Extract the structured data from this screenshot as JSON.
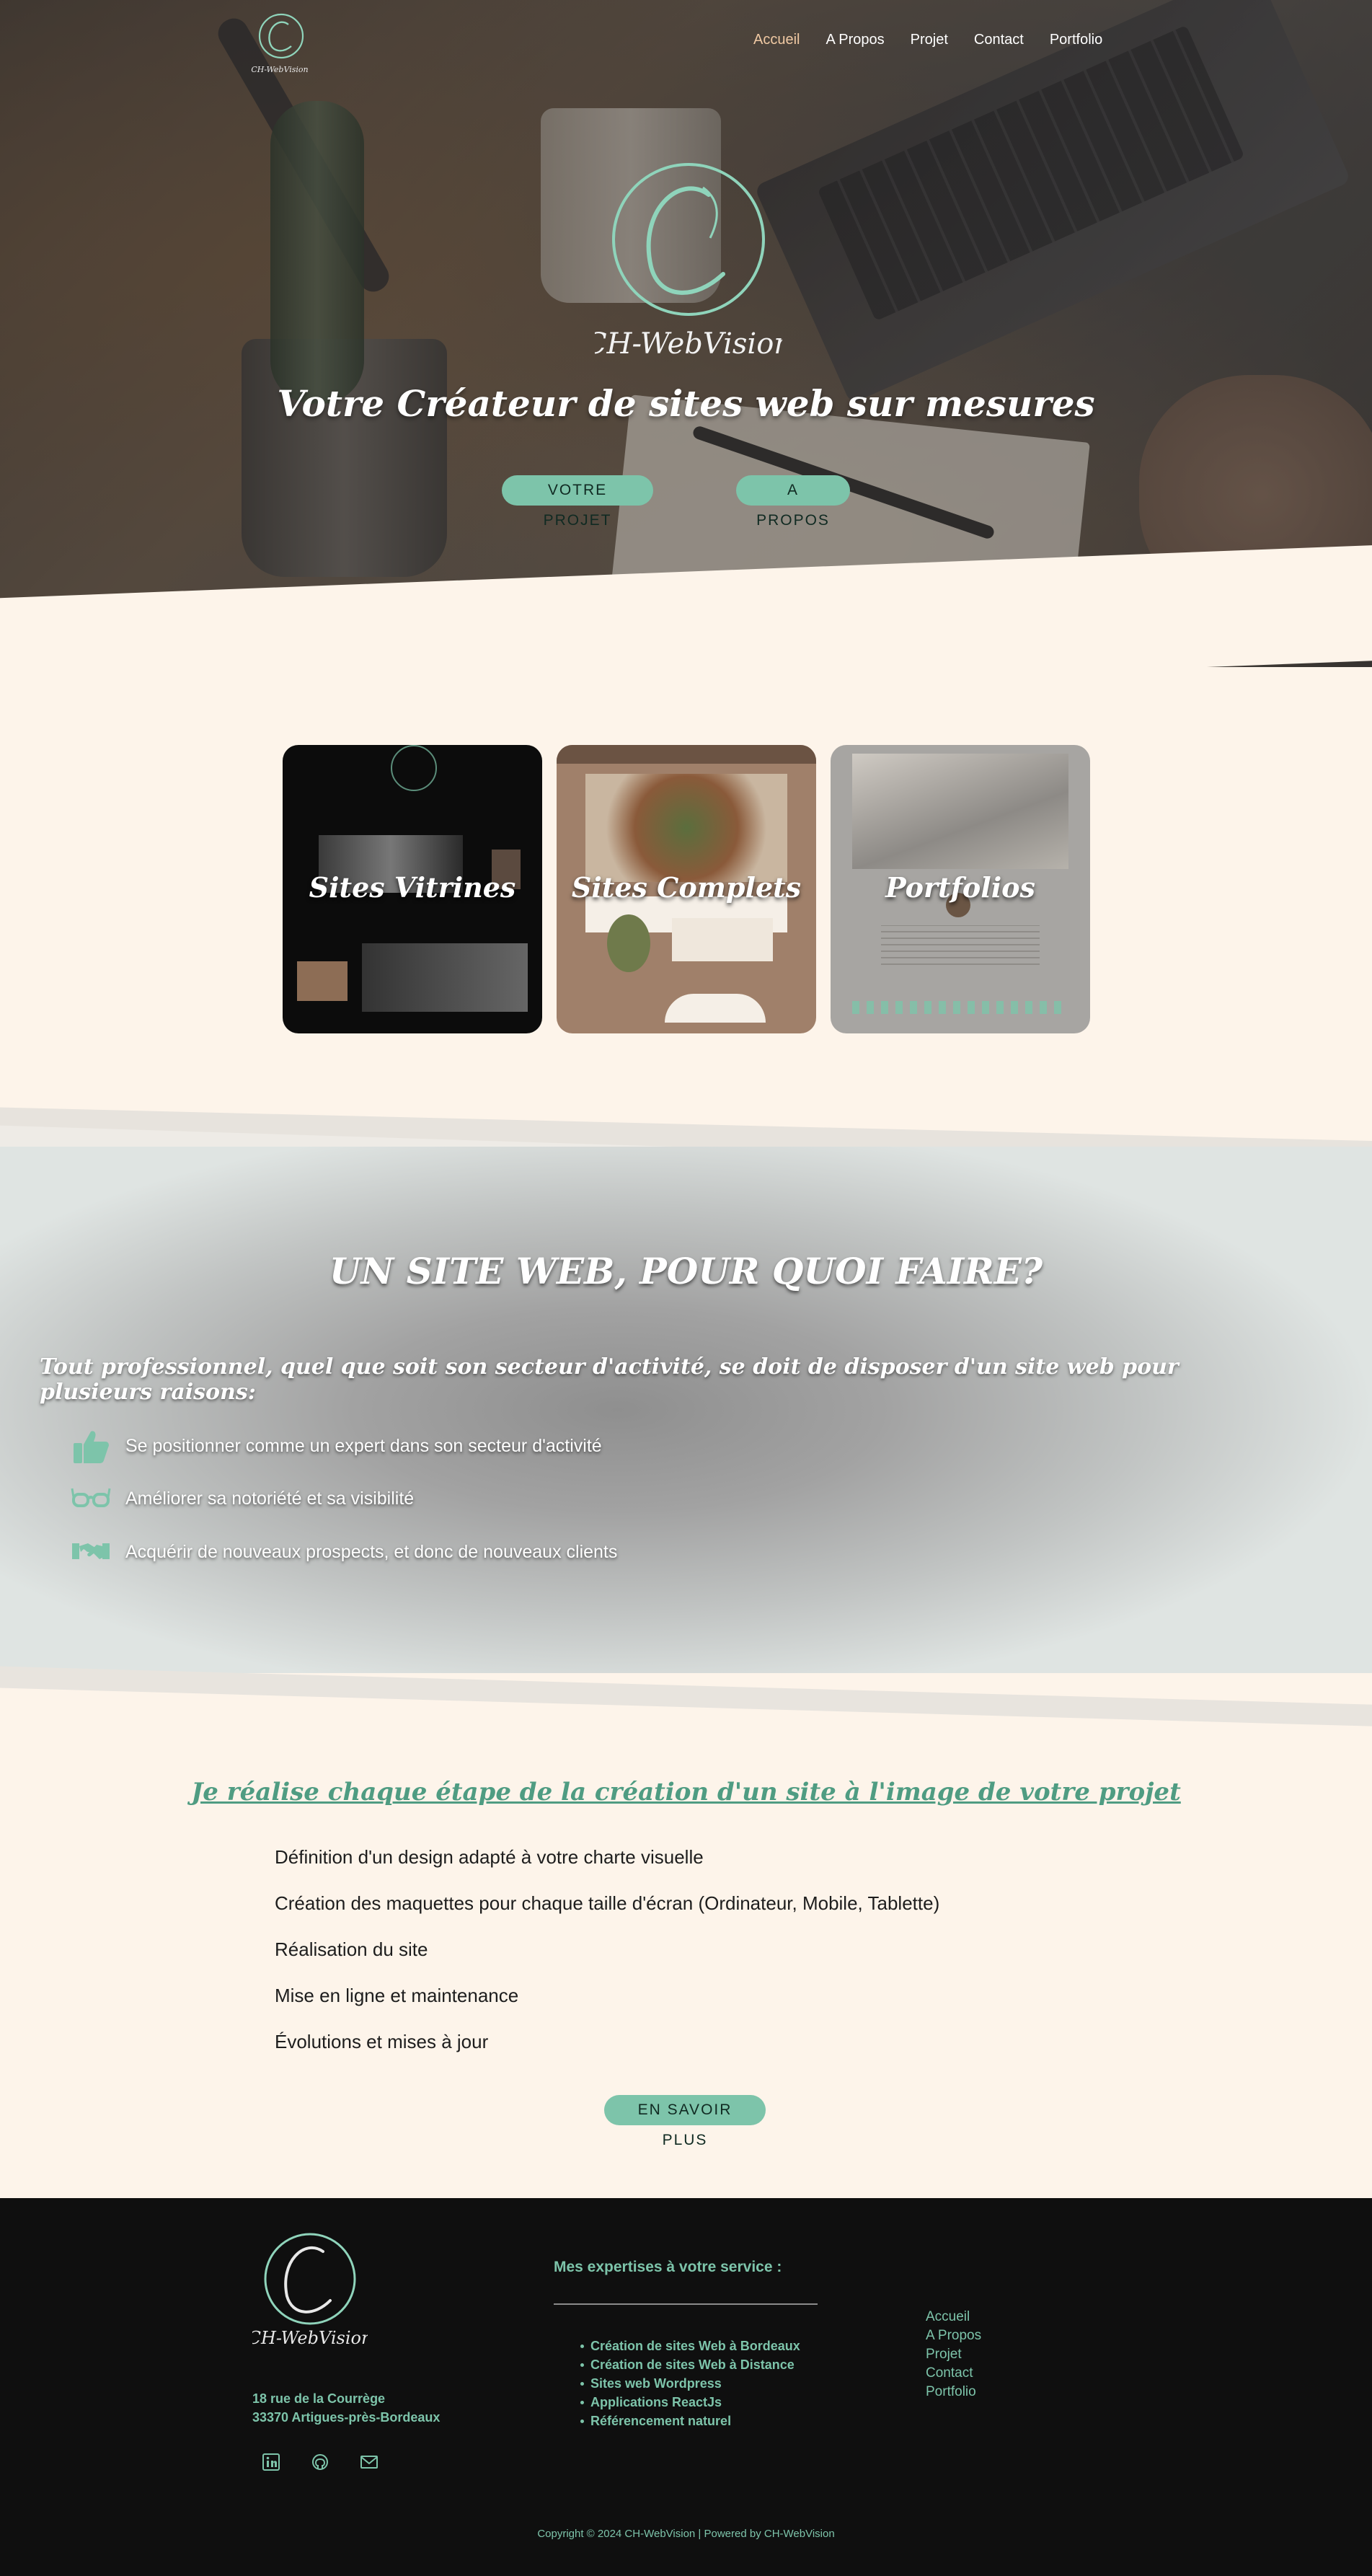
{
  "brand": {
    "name": "CH-WebVision",
    "accent": "#7dc4aa",
    "nav_active": "#f0c9a3"
  },
  "nav": {
    "items": [
      {
        "label": "Accueil",
        "active": true
      },
      {
        "label": "A Propos",
        "active": false
      },
      {
        "label": "Projet",
        "active": false
      },
      {
        "label": "Contact",
        "active": false
      },
      {
        "label": "Portfolio",
        "active": false
      }
    ]
  },
  "hero": {
    "title": "Votre Créateur de sites web sur mesures",
    "buttons": {
      "projet": "VOTRE PROJET",
      "apropos": "A PROPOS"
    }
  },
  "cards": [
    {
      "title": "Sites Vitrines"
    },
    {
      "title": "Sites Complets"
    },
    {
      "title": "Portfolios"
    }
  ],
  "why": {
    "title": "UN SITE WEB, POUR QUOI FAIRE?",
    "subtitle": "Tout professionnel, quel que soit son secteur d'activité, se doit de disposer d'un site web pour plusieurs raisons:",
    "reasons": [
      {
        "icon": "thumbs-up-icon",
        "text": "Se positionner comme un expert dans son secteur d'activité"
      },
      {
        "icon": "glasses-icon",
        "text": "Améliorer sa notoriété et sa visibilité"
      },
      {
        "icon": "handshake-icon",
        "text": "Acquérir de nouveaux prospects, et donc de nouveaux clients"
      }
    ]
  },
  "process": {
    "title": "Je réalise chaque étape de la création d'un site à l'image de votre projet",
    "steps": [
      "Définition d'un design adapté à votre charte visuelle",
      "Création des maquettes pour chaque taille d'écran (Ordinateur, Mobile, Tablette)",
      "Réalisation du site",
      "Mise en ligne et maintenance",
      "Évolutions et mises à jour"
    ],
    "button": "EN SAVOIR PLUS"
  },
  "footer": {
    "address_line1": "18 rue de la Courrège",
    "address_line2": "33370 Artigues-près-Bordeaux",
    "social": [
      "linkedin-icon",
      "github-icon",
      "mail-icon"
    ],
    "expertise_title": "Mes expertises à votre service :",
    "expertises": [
      "Création de sites Web à Bordeaux",
      "Création de sites Web à Distance",
      "Sites web Wordpress",
      "Applications ReactJs",
      "Référencement naturel"
    ],
    "nav": [
      "Accueil",
      "A Propos",
      "Projet",
      "Contact",
      "Portfolio"
    ],
    "copyright": "Copyright © 2024 CH-WebVision | Powered by CH-WebVision"
  }
}
